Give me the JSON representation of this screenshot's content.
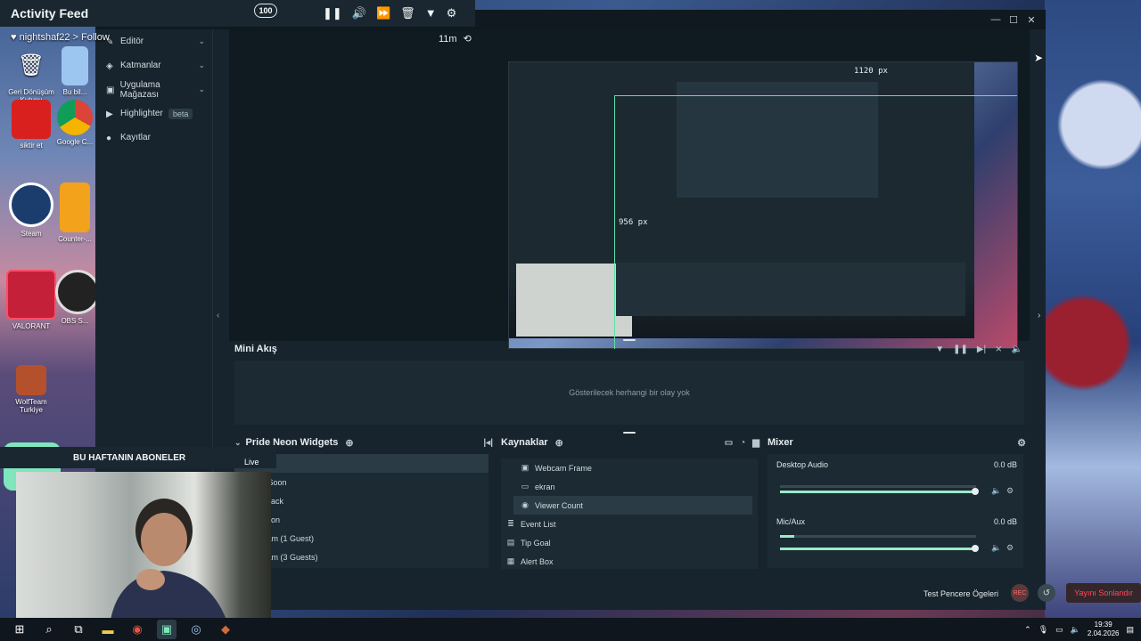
{
  "activity_feed": {
    "title": "Activity Feed",
    "follow_text": "nightshaf22 > Follow",
    "timer": "11m",
    "tools": [
      "pause-icon",
      "volume-icon",
      "skip-icon",
      "trash-icon",
      "filter-icon",
      "gear-icon"
    ]
  },
  "desktop": {
    "icons": [
      {
        "label": "Geri Dönüşüm Kutusu"
      },
      {
        "label": "Bu bil..."
      },
      {
        "label": "siktir et"
      },
      {
        "label": "Google C..."
      },
      {
        "label": "Steam"
      },
      {
        "label": "Counter-..."
      },
      {
        "label": "VALORANT"
      },
      {
        "label": "OBS S..."
      },
      {
        "label": "WolfTeam Turkiye"
      }
    ]
  },
  "nav": {
    "items": [
      {
        "label": "Editör",
        "icon": "editor-icon"
      },
      {
        "label": "Katmanlar",
        "icon": "layers-icon"
      },
      {
        "label": "Uygulama Mağazası",
        "icon": "store-icon"
      },
      {
        "label": "Highlighter",
        "icon": "highlighter-icon",
        "badge": "beta"
      },
      {
        "label": "Kayıtlar",
        "icon": "recordings-icon"
      }
    ]
  },
  "preview": {
    "width_label": "1120 px",
    "height_label": "956 px"
  },
  "mini_feed": {
    "title": "Mini Akış",
    "empty_text": "Gösterilecek herhangi bir olay yok"
  },
  "widgets": {
    "title": "Pride Neon Widgets",
    "items": [
      "g Soon",
      "t Back",
      "Soon",
      "Cam (1 Guest)",
      "Cam (3 Guests)"
    ]
  },
  "sources": {
    "title": "Kaynaklar",
    "items": [
      {
        "label": "Webcam Frame",
        "icon": "image-icon",
        "indent": true
      },
      {
        "label": "ekran",
        "icon": "monitor-icon",
        "indent": true
      },
      {
        "label": "Viewer Count",
        "icon": "eye-icon",
        "indent": true,
        "selected": true
      },
      {
        "label": "Event List",
        "icon": "list-icon",
        "indent": false
      },
      {
        "label": "Tip Goal",
        "icon": "goal-icon",
        "indent": false
      },
      {
        "label": "Alert Box",
        "icon": "alert-icon",
        "indent": false
      }
    ]
  },
  "mixer": {
    "title": "Mixer",
    "channels": [
      {
        "name": "Desktop Audio",
        "db": "0.0 dB",
        "level": 1.0
      },
      {
        "name": "Mic/Aux",
        "db": "0.0 dB",
        "level": 1.0
      }
    ]
  },
  "bottom": {
    "test_label": "Test Pencere Ögeleri",
    "rec_label": "REC",
    "end_label": "Yayını Sonlandır"
  },
  "subs_overlay": {
    "title": "BU HAFTANIN ABONELER",
    "count": "100",
    "live": "Live"
  },
  "taskbar": {
    "time": "19:39",
    "date": "2.04.2026"
  },
  "colors": {
    "accent": "#5fe0a8",
    "panel": "#1b2a33",
    "end_button": "#ff4a5a"
  }
}
